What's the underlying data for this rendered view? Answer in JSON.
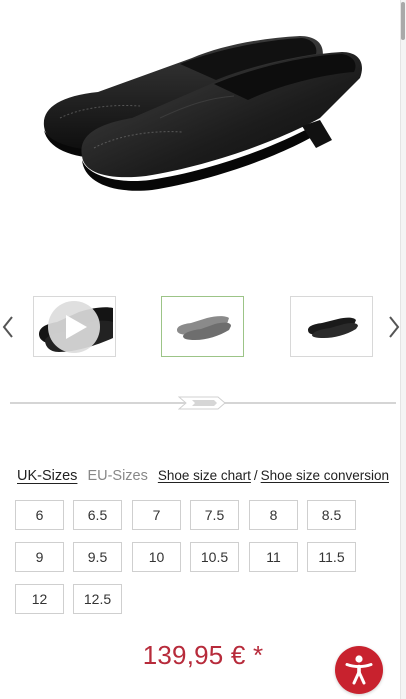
{
  "product": {
    "hero_image": "black-leather-loafers",
    "thumbnails": [
      {
        "icon": "video-thumbnail",
        "has_play": true,
        "selected": false
      },
      {
        "icon": "grey-loafer-thumbnail",
        "has_play": false,
        "selected": true
      },
      {
        "icon": "black-loafer-thumbnail",
        "has_play": false,
        "selected": false
      }
    ]
  },
  "sizes": {
    "tabs": [
      "UK-Sizes",
      "EU-Sizes"
    ],
    "active_tab": "UK-Sizes",
    "links": {
      "chart": "Shoe size chart",
      "separator": "/",
      "conversion": "Shoe size conversion"
    },
    "values": [
      "6",
      "6.5",
      "7",
      "7.5",
      "8",
      "8.5",
      "9",
      "9.5",
      "10",
      "10.5",
      "11",
      "11.5",
      "12",
      "12.5"
    ]
  },
  "price": {
    "text": "139,95 € *",
    "color": "#b72b3b"
  },
  "accessibility": {
    "icon": "accessibility-icon",
    "color": "#c8222e"
  }
}
